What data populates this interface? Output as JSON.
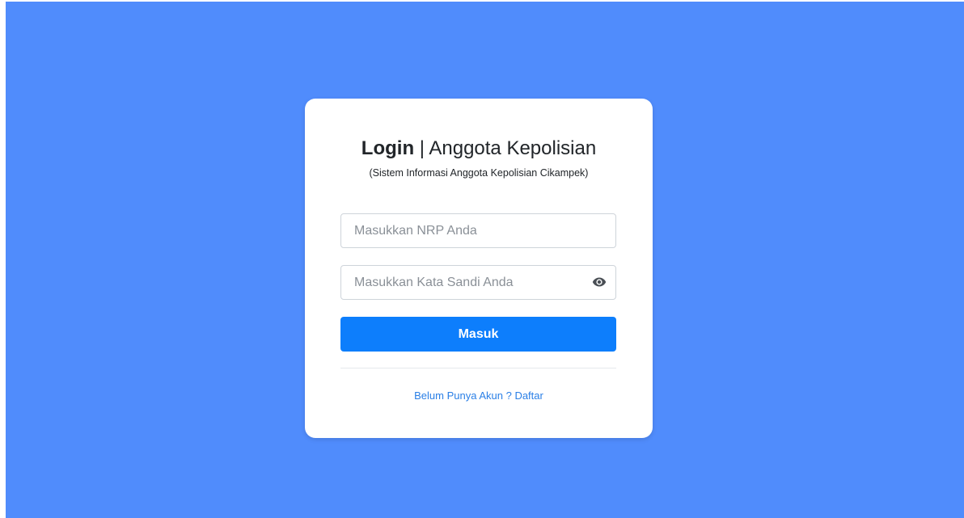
{
  "login": {
    "title_bold": "Login",
    "title_separator": "|",
    "title_rest": "Anggota Kepolisian",
    "subtitle": "(Sistem Informasi Anggota Kepolisian Cikampek)",
    "nrp_placeholder": "Masukkan NRP Anda",
    "password_placeholder": "Masukkan Kata Sandi Anda",
    "password_toggle_icon": "eye-icon",
    "submit_label": "Masuk",
    "register_link": "Belum Punya Akun ? Daftar"
  },
  "colors": {
    "background": "#508cfc",
    "card": "#ffffff",
    "primary_button": "#0d7efc",
    "link": "#2a7fe6"
  }
}
